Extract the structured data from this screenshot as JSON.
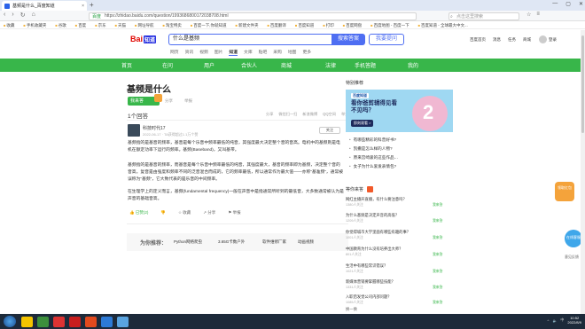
{
  "browser": {
    "tab_title": "基频是什么_百度知道",
    "tab_close": "×",
    "new_tab": "+",
    "window_controls": [
      "—",
      "▢",
      "✕"
    ],
    "nav_buttons": [
      "‹",
      "›",
      "↻",
      "⌂"
    ],
    "secure_label": "百度",
    "url": "https://zhidao.baidu.com/question/1993686800172038708.html",
    "search_placeholder": "点击这里搜索",
    "right_buttons": [
      "☆",
      "≡"
    ],
    "bookmarks": [
      "收藏",
      "手机收藏夹",
      "谷歌",
      "百度",
      "京东",
      "天猫",
      "网址导航",
      "淘宝特卖",
      "百度一下,你就知道",
      "新建文件夹",
      "百度翻译",
      "百度知道",
      "打印",
      "百度网盘",
      "百度地图 - 百度一下",
      "百度知道 - 全球最大中文..."
    ]
  },
  "header": {
    "logo_text": "Bai",
    "logo_badge": "知道",
    "query": "什么是基频",
    "search_button": "搜索答案",
    "ask_button": "我要提问",
    "top_links": [
      "百度首页",
      "消息",
      "任务",
      "商城"
    ],
    "login_text": "登录",
    "nav_links": [
      "网页",
      "资讯",
      "视频",
      "图片",
      "知道",
      "文库",
      "贴吧",
      "采购",
      "地图",
      "更多"
    ],
    "nav_active": "知道"
  },
  "green_nav": [
    "首页",
    "在问",
    "用户",
    "合伙人",
    "商城",
    "法律",
    "手机答题",
    "我的"
  ],
  "question": {
    "title": "基频是什么",
    "answer_button": "我来答",
    "like": "分享",
    "share": "举报",
    "actions": [
      "分享",
      "微信扫一扫",
      "新浪微博",
      "QQ空间",
      "举报"
    ],
    "answer_count": "1个回答"
  },
  "answer": {
    "user_name": "科技时代17",
    "date": "2022-06-17 · TA获得超过1.1万个赞",
    "follow": "关注",
    "paragraphs": [
      "基频指的是基音的频率，基音是每个乐音中频率最低的纯音，其强度最大决定整个音的音高。电机中的基频则是电机在额定功率下运行的频率。基频(Baseband)，又叫基带。",
      "基频指的是基音的频率，而基音是每个乐音中频率最低的纯音，其强度最大，基音的频率即为基频，决定整个音的音高。复音是由强度和频率不同的泛音混合而成的，它的频率最低，所以通常作为最大值——亦称“基准频”，通常被误称为“基频”，它大致代表的是乐音的中间频率。",
      "在生理学上的定义而言，基频(fundamental frequency)一般在声音中是指通常所听到的最低音，大多数通常被认为是声音的基础音高。"
    ],
    "action_bar": [
      "👍 已赞(2)",
      "👎",
      "☆ 收藏",
      "↗ 分享",
      "⚑ 举报"
    ]
  },
  "recommend": {
    "label": "为你推荐：",
    "items": [
      "Python网络爬虫",
      "3.65G卡数户外",
      "软件维修厂家",
      "动画视频"
    ]
  },
  "sidebar": {
    "section_title": "特别推荐",
    "banner": {
      "brand": "百度知道",
      "headline": "看你爸剪辑得见看不见吗？",
      "tag": "即刻观看 >"
    },
    "recommend_items": [
      "有哪些精彩的科普好书?",
      "凯撒是怎么样的人物?",
      "原来宫崎骏的这些作品…",
      "女子为什么爱发表情包?"
    ],
    "hot_title": "等你来答",
    "hot_questions": [
      {
        "q": "网红主播开直播，有什么要注意吗？",
        "meta": "1380人关注",
        "ans": "我来答"
      },
      {
        "q": "为什么基频是决定声音的高低？",
        "meta": "1209人关注",
        "ans": "我来答"
      },
      {
        "q": "你觉得城市大学里面有哪些有趣的事？",
        "meta": "1001人关注",
        "ans": "我来答"
      },
      {
        "q": "中国教育为什么没有培养出大师？",
        "meta": "801人关注",
        "ans": "我来答"
      },
      {
        "q": "生活中有哪些常识错误？",
        "meta": "1021人关注",
        "ans": "我来答"
      },
      {
        "q": "新媒体营销要掌握哪些技能？",
        "meta": "1331人关注",
        "ans": "我来答"
      },
      {
        "q": "入职后发觉公司内部问题？",
        "meta": "1085人关注",
        "ans": "我来答"
      }
    ],
    "more_text": "换一换"
  },
  "floating": {
    "ad1": "领取红包",
    "ad2": "在线客服",
    "feedback": "意见反馈"
  },
  "taskbar": {
    "time": "10:52",
    "date": "2022/8/9",
    "tray_icons": [
      "^",
      "🔈",
      "中"
    ]
  }
}
